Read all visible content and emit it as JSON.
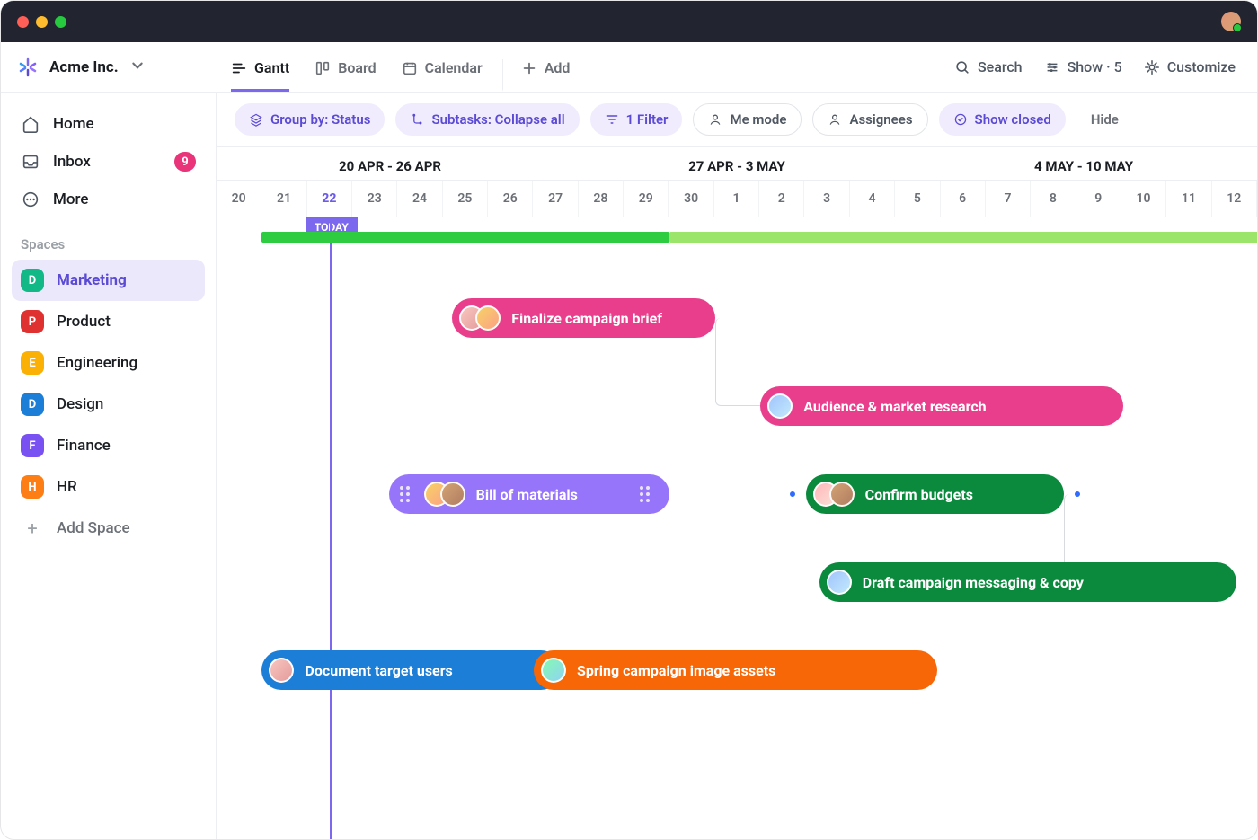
{
  "workspace": {
    "name": "Acme Inc."
  },
  "views": {
    "gantt": "Gantt",
    "board": "Board",
    "calendar": "Calendar",
    "add": "Add"
  },
  "topRight": {
    "search": "Search",
    "show": "Show · 5",
    "customize": "Customize"
  },
  "sidebar": {
    "home": "Home",
    "inbox": "Inbox",
    "inbox_badge": "9",
    "more": "More",
    "section": "Spaces",
    "addSpace": "Add Space",
    "spaces": [
      {
        "letter": "D",
        "label": "Marketing",
        "color": "#12b886",
        "active": true
      },
      {
        "letter": "P",
        "label": "Product",
        "color": "#e03131",
        "active": false
      },
      {
        "letter": "E",
        "label": "Engineering",
        "color": "#fab005",
        "active": false
      },
      {
        "letter": "D",
        "label": "Design",
        "color": "#1c7ed6",
        "active": false
      },
      {
        "letter": "F",
        "label": "Finance",
        "color": "#7950f2",
        "active": false
      },
      {
        "letter": "H",
        "label": "HR",
        "color": "#fd7e14",
        "active": false
      }
    ]
  },
  "filters": {
    "group": "Group by: Status",
    "subtasks": "Subtasks: Collapse all",
    "filter": "1 Filter",
    "me": "Me mode",
    "assignees": "Assignees",
    "closed": "Show closed",
    "hide": "Hide"
  },
  "timeline": {
    "weeks": [
      "20 APR - 26 APR",
      "27 APR - 3 MAY",
      "4 MAY - 10 MAY"
    ],
    "days": [
      "20",
      "21",
      "22",
      "23",
      "24",
      "25",
      "26",
      "27",
      "28",
      "29",
      "30",
      "1",
      "2",
      "3",
      "4",
      "5",
      "6",
      "7",
      "8",
      "9",
      "10",
      "11",
      "12"
    ],
    "todayIndex": 2,
    "todayLabel": "TODAY",
    "progress": {
      "startIndex": 1,
      "completeEndIndex": 10,
      "totalEndIndex": 23,
      "completeColor": "#2ecc40",
      "pendingColor": "#9be56b"
    }
  },
  "tasks": [
    {
      "id": "t1",
      "label": "Finalize campaign brief",
      "color": "#e83e8c",
      "startIndex": 5.2,
      "endIndex": 11,
      "row": 0,
      "avatars": [
        "c1",
        "c2"
      ]
    },
    {
      "id": "t2",
      "label": "Audience & market research",
      "color": "#e83e8c",
      "startIndex": 12,
      "endIndex": 20,
      "row": 1,
      "avatars": [
        "c3"
      ]
    },
    {
      "id": "t3",
      "label": "Bill of materials",
      "color": "#9775fa",
      "startIndex": 3.8,
      "endIndex": 10,
      "row": 2,
      "avatars": [
        "c2",
        "c4"
      ],
      "grip": true
    },
    {
      "id": "t4",
      "label": "Confirm budgets",
      "color": "#0b8a3d",
      "startIndex": 13,
      "endIndex": 18.7,
      "row": 2,
      "avatars": [
        "c6",
        "c4"
      ],
      "milestones": true
    },
    {
      "id": "t5",
      "label": "Draft campaign messaging & copy",
      "color": "#0b8a3d",
      "startIndex": 13.3,
      "endIndex": 22.5,
      "row": 3,
      "avatars": [
        "c3"
      ]
    },
    {
      "id": "t6",
      "label": "Document target users",
      "color": "#1c7ed6",
      "startIndex": 1,
      "endIndex": 7.6,
      "row": 4,
      "avatars": [
        "c1"
      ]
    },
    {
      "id": "t7",
      "label": "Spring campaign image assets",
      "color": "#f76707",
      "startIndex": 7,
      "endIndex": 15.9,
      "row": 4,
      "avatars": [
        "c5"
      ]
    }
  ],
  "colors": {
    "accent": "#7b68ee"
  }
}
